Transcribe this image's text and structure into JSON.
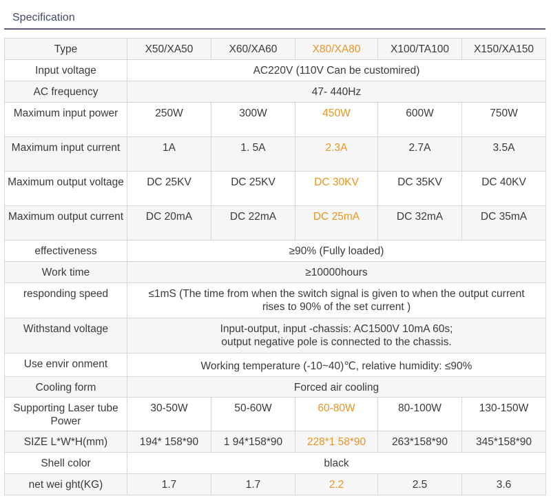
{
  "header": {
    "title": "Specification"
  },
  "table": {
    "rows": [
      {
        "label": "Type",
        "cells": [
          "X50/XA50",
          "X60/XA60",
          "X80/XA80",
          "X100/TA100",
          "X150/XA150"
        ]
      },
      {
        "label": "Input voltage",
        "span": "AC220V (110V Can be customired)"
      },
      {
        "label": "AC frequency",
        "span": "47- 440Hz"
      },
      {
        "label": "Maximum input power",
        "cells": [
          "250W",
          "300W",
          "450W",
          "600W",
          "750W"
        ]
      },
      {
        "label": "Maximum input current",
        "cells": [
          "1A",
          "1. 5A",
          "2.3A",
          "2.7A",
          "3.5A"
        ]
      },
      {
        "label": "Maximum output voltage",
        "cells": [
          "DC 25KV",
          "DC 25KV",
          "DC 30KV",
          "DC 35KV",
          "DC 40KV"
        ]
      },
      {
        "label": "Maximum output current",
        "cells": [
          "DC 20mA",
          "DC 22mA",
          "DC 25mA",
          "DC 32mA",
          "DC 35mA"
        ]
      },
      {
        "label": "effectiveness",
        "span": "≥90% (Fully loaded)"
      },
      {
        "label": "Work time",
        "span": "≥10000hours"
      },
      {
        "label": "responding speed",
        "span": "≤1mS (The time from when the switch signal is given to when the output current rises to 90% of the set current )"
      },
      {
        "label": "Withstand voltage",
        "span_lines": [
          "Input-output, input -chassis: AC1500V 10mA 60s;",
          "output negative pole is connected to the chassis."
        ]
      },
      {
        "label": "Use envir onment",
        "span": "Working temperature (-10~40)℃, relative humidity: ≤90%"
      },
      {
        "label": "Cooling form",
        "span": "Forced air cooling"
      },
      {
        "label": "Supporting Laser tube Power",
        "cells": [
          "30-50W",
          "50-60W",
          "60-80W",
          "80-100W",
          "130-150W"
        ]
      },
      {
        "label": "SIZE L*W*H(mm)",
        "cells": [
          "194* 158*90",
          "1 94*158*90",
          "228*1 58*90",
          "263*158*90",
          "345*158*90"
        ]
      },
      {
        "label": "Shell color",
        "span": "black"
      },
      {
        "label": "net wei ght(KG)",
        "cells": [
          "1.7",
          "1.7",
          "2.2",
          "2.5",
          "3.6"
        ]
      }
    ]
  },
  "colors": {
    "highlight": "#e8951f",
    "rule": "#5a5a8c"
  }
}
